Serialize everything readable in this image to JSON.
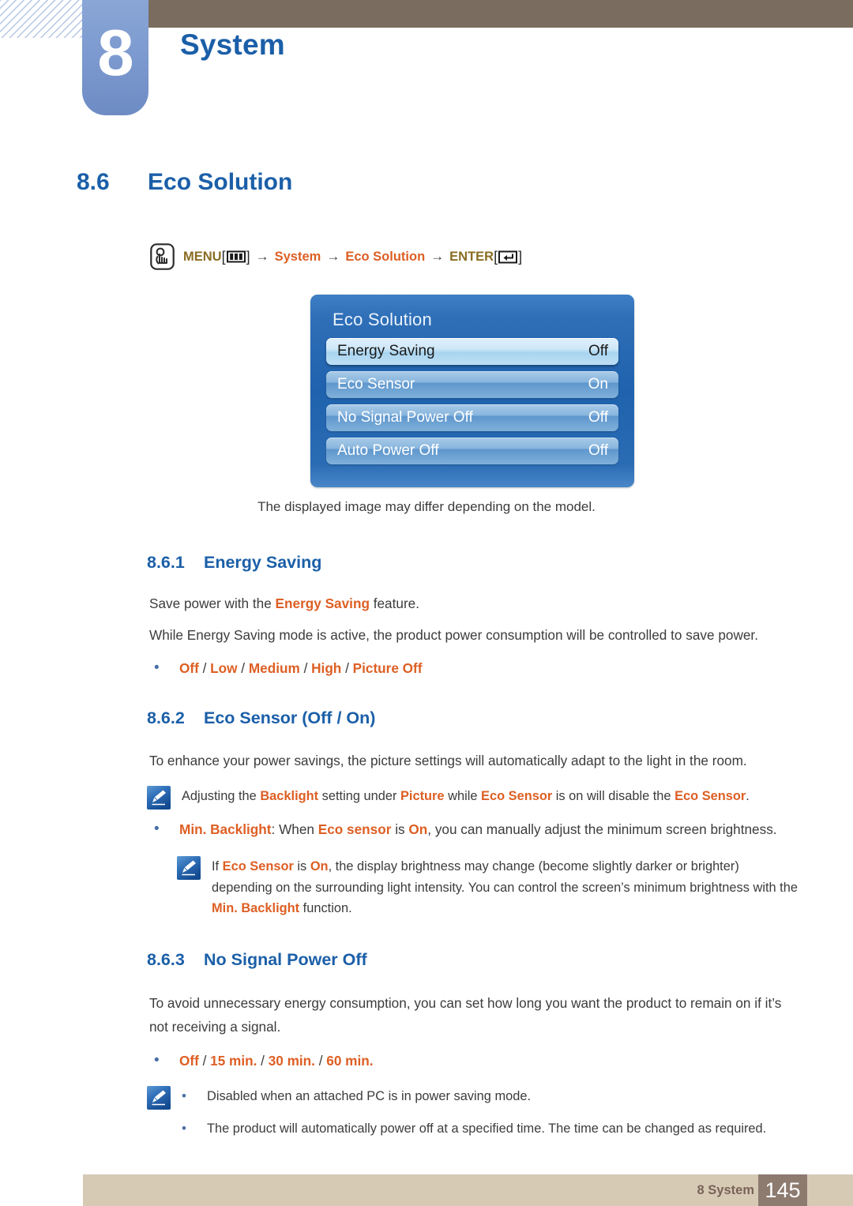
{
  "header": {
    "chapter_number": "8",
    "chapter_title": "System"
  },
  "section": {
    "number": "8.6",
    "title": "Eco Solution"
  },
  "menu_path": {
    "touch_icon": "touch-hand-icon",
    "menu_label": "MENU",
    "menu_key_icon": "menu-key-icon",
    "arrow": "→",
    "step_system": "System",
    "step_eco_solution": "Eco Solution",
    "enter_label": "ENTER",
    "enter_key_icon": "enter-key-icon",
    "bracket_open": "[",
    "bracket_close": "]"
  },
  "osd": {
    "title": "Eco Solution",
    "rows": [
      {
        "label": "Energy Saving",
        "value": "Off",
        "selected": true
      },
      {
        "label": "Eco Sensor",
        "value": "On",
        "selected": false
      },
      {
        "label": "No Signal Power Off",
        "value": "Off",
        "selected": false
      },
      {
        "label": "Auto Power Off",
        "value": "Off",
        "selected": false
      }
    ],
    "caption": "The displayed image may differ depending on the model."
  },
  "sub_861": {
    "number": "8.6.1",
    "title": "Energy Saving",
    "p1_a": "Save power with the ",
    "p1_b": "Energy Saving",
    "p1_c": " feature.",
    "p2": "While Energy Saving mode is active, the product power consumption will be controlled to save power.",
    "bullet_dot": "•",
    "opt1": "Off",
    "sep": " / ",
    "opt2": "Low",
    "opt3": "Medium",
    "opt4": "High",
    "opt5": "Picture Off"
  },
  "sub_862": {
    "number": "8.6.2",
    "title": "Eco Sensor (Off / On)",
    "p1": "To enhance your power savings, the picture settings will automatically adapt to the light in the room.",
    "note1_a": "Adjusting the ",
    "note1_b": "Backlight",
    "note1_c": " setting under ",
    "note1_d": "Picture",
    "note1_e": " while ",
    "note1_f": "Eco Sensor",
    "note1_g": " is on will disable the ",
    "note1_h": "Eco Sensor",
    "note1_i": ".",
    "bullet_dot": "•",
    "b1_a": "Min. Backlight",
    "b1_b": ": When ",
    "b1_c": "Eco sensor",
    "b1_d": " is ",
    "b1_e": "On",
    "b1_f": ", you can manually adjust the minimum screen brightness.",
    "note2_a": "If ",
    "note2_b": "Eco Sensor",
    "note2_c": " is ",
    "note2_d": "On",
    "note2_e": ", the display brightness may change (become slightly darker or brighter) depending on the surrounding light intensity. You can control the screen’s minimum brightness with the ",
    "note2_f": "Min. Backlight",
    "note2_g": " function."
  },
  "sub_863": {
    "number": "8.6.3",
    "title": "No Signal Power Off",
    "p1": "To avoid unnecessary energy consumption, you can set how long you want the product to remain on if it’s not receiving a signal.",
    "bullet_dot": "•",
    "opt1": "Off",
    "sep": " / ",
    "opt2": "15 min.",
    "opt3": "30 min.",
    "opt4": "60 min.",
    "note_item1": "Disabled when an attached PC is in power saving mode.",
    "note_item2": "The product will automatically power off at a specified time. The time can be changed as required."
  },
  "footer": {
    "chapter_ref": "8 System",
    "page_number": "145"
  },
  "colors": {
    "heading_blue": "#1b5fa8",
    "accent_orange": "#dd5f24",
    "menu_gold": "#8a6d22",
    "header_brown": "#7a6c5e",
    "footer_tan": "#d6cab5",
    "footer_page_brown": "#8d7b70",
    "tab_blue": "#7d9bd0",
    "osd_blue": "#1f62ad",
    "body_text": "#3c3c3c"
  }
}
